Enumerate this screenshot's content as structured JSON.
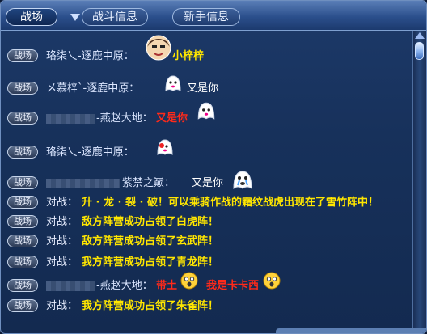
{
  "tabs": [
    {
      "label": "战场",
      "active": true
    },
    {
      "label": "战斗信息",
      "active": false
    },
    {
      "label": "新手信息",
      "active": false
    }
  ],
  "messages": [
    {
      "badge": "战场",
      "name": "珞柒乀-逐鹿中原：",
      "text": "小梓梓",
      "text_color": "#ffe600",
      "emote": "face-emote"
    },
    {
      "badge": "战场",
      "name": "メ慕梓`-逐鹿中原：",
      "text": "又是你",
      "text_color": "#ffffff",
      "emote": "ghost-emote"
    },
    {
      "badge": "战场",
      "name": "-燕赵大地：",
      "text": "又是你",
      "text_color": "#ff2a1a",
      "emote": "ghost-emote"
    },
    {
      "badge": "战场",
      "name": "珞柒乀-逐鹿中原：",
      "text": "",
      "text_color": "#ffffff",
      "emote": "ghost-red-emote"
    },
    {
      "badge": "战场",
      "name": "紫禁之巅：",
      "text": "又是你",
      "text_color": "#ffffff",
      "emote": "crying-emote"
    },
    {
      "badge": "战场",
      "label": "对战：",
      "text": "升 · 龙 · 裂 · 破！可以乘骑作战的霜纹战虎出现在了雪竹阵中！",
      "text_color": "#ffe600"
    },
    {
      "badge": "战场",
      "label": "对战：",
      "text": "敌方阵营成功占领了白虎阵！",
      "text_color": "#ffe600"
    },
    {
      "badge": "战场",
      "label": "对战：",
      "text": "敌方阵营成功占领了玄武阵！",
      "text_color": "#ffe600"
    },
    {
      "badge": "战场",
      "label": "对战：",
      "text": "我方阵营成功占领了青龙阵！",
      "text_color": "#ffe600"
    },
    {
      "badge": "战场",
      "name": "-燕赵大地：",
      "text": "带土",
      "text2": "我是卡卡西",
      "text_color": "#ff2a1a",
      "emote": "shocked-emote"
    },
    {
      "badge": "战场",
      "label": "对战：",
      "text": "我方阵营成功占领了朱雀阵！",
      "text_color": "#ffe600"
    }
  ]
}
